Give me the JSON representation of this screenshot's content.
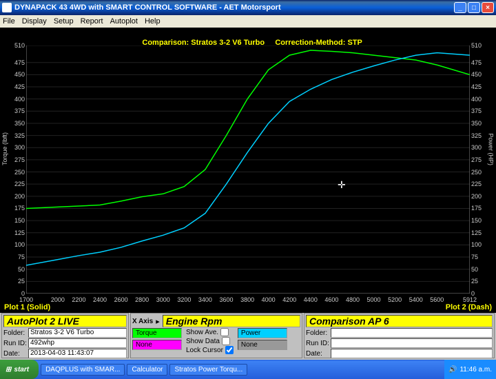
{
  "window": {
    "title": "DYNAPACK 43 4WD with SMART CONTROL SOFTWARE - AET Motorsport"
  },
  "menu": [
    "File",
    "Display",
    "Setup",
    "Report",
    "Autoplot",
    "Help"
  ],
  "chart_header": {
    "comparison_label": "Comparison:",
    "comparison_value": "Stratos 3-2 V6 Turbo",
    "correction_label": "Correction-Method:",
    "correction_value": "STP"
  },
  "plot_labels": {
    "left": "Plot 1 (Solid)",
    "right": "Plot 2 (Dash)"
  },
  "axes": {
    "y_left_label": "Torque (lbft)",
    "y_right_label": "Power (HP)",
    "ylim": [
      0,
      510
    ],
    "yticks": [
      0,
      25,
      50,
      75,
      100,
      125,
      150,
      175,
      200,
      225,
      250,
      275,
      300,
      325,
      350,
      375,
      400,
      425,
      450,
      475,
      510
    ],
    "xlim": [
      1700,
      5912
    ],
    "xticks": [
      1700,
      2000,
      2200,
      2400,
      2600,
      2800,
      3000,
      3200,
      3400,
      3600,
      3800,
      4000,
      4200,
      4400,
      4600,
      4800,
      5000,
      5200,
      5400,
      5600,
      5912
    ]
  },
  "chart_data": {
    "type": "line",
    "x": [
      1700,
      2000,
      2200,
      2400,
      2600,
      2800,
      3000,
      3200,
      3400,
      3600,
      3800,
      4000,
      4200,
      4400,
      4600,
      4800,
      5000,
      5200,
      5400,
      5600,
      5912
    ],
    "series": [
      {
        "name": "Torque (lbft)",
        "color": "#00ff00",
        "values": [
          175,
          178,
          180,
          182,
          190,
          199,
          205,
          220,
          255,
          325,
          400,
          460,
          490,
          500,
          498,
          495,
          490,
          485,
          480,
          470,
          450
        ]
      },
      {
        "name": "Power (HP)",
        "color": "#00d0ff",
        "values": [
          58,
          70,
          78,
          85,
          95,
          108,
          120,
          135,
          165,
          225,
          290,
          350,
          395,
          420,
          440,
          455,
          468,
          480,
          490,
          495,
          490
        ]
      }
    ],
    "title": "Comparison: Stratos 3-2 V6 Turbo    Correction-Method: STP",
    "xlabel": "Engine Rpm",
    "ylabel_left": "Torque (lbft)",
    "ylabel_right": "Power (HP)",
    "ylim": [
      0,
      510
    ],
    "xlim": [
      1700,
      5912
    ]
  },
  "controls": {
    "live_box": "AutoPlot 2 LIVE",
    "xaxis_label": "X Axis",
    "xaxis_value": "Engine Rpm",
    "comparison_box": "Comparison AP 6",
    "folder_label": "Folder:",
    "folder_value": "Stratos 3-2 V6 Turbo",
    "runid_label": "Run ID:",
    "runid_value": "492whp",
    "date_label": "Date:",
    "date_value": "2013-04-03 11:43:07",
    "torque_btn": "Torque",
    "none_btn": "None",
    "power_btn": "Power",
    "none2_btn": "None",
    "show_avg": "Show Ave.",
    "show_data": "Show Data",
    "lock_cursor": "Lock Cursor",
    "lock_cursor_checked": true
  },
  "taskbar": {
    "start": "start",
    "items": [
      "DAQPLUS with SMAR...",
      "Calculator",
      "Stratos Power Torqu..."
    ],
    "clock": "11:46 a.m."
  }
}
